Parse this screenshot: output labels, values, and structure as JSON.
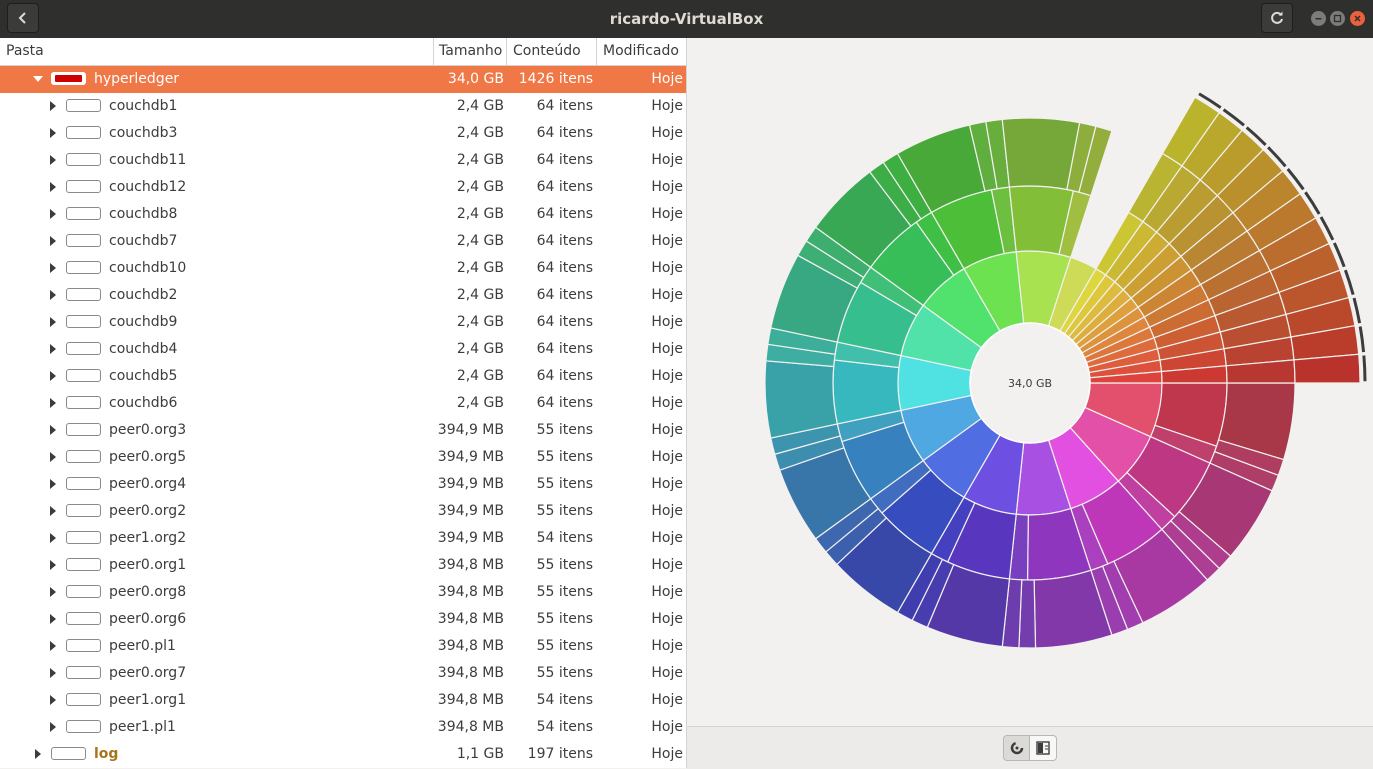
{
  "window": {
    "title": "ricardo-VirtualBox"
  },
  "columns": {
    "name": "Pasta",
    "size": "Tamanho",
    "contents": "Conteúdo",
    "modified": "Modificado"
  },
  "rows": [
    {
      "name": "hyperledger",
      "size": "34,0 GB",
      "contents": "1426 itens",
      "modified": "Hoje",
      "level": 0,
      "expanded": true,
      "selected": true
    },
    {
      "name": "couchdb1",
      "size": "2,4 GB",
      "contents": "64 itens",
      "modified": "Hoje",
      "level": 1
    },
    {
      "name": "couchdb3",
      "size": "2,4 GB",
      "contents": "64 itens",
      "modified": "Hoje",
      "level": 1
    },
    {
      "name": "couchdb11",
      "size": "2,4 GB",
      "contents": "64 itens",
      "modified": "Hoje",
      "level": 1
    },
    {
      "name": "couchdb12",
      "size": "2,4 GB",
      "contents": "64 itens",
      "modified": "Hoje",
      "level": 1
    },
    {
      "name": "couchdb8",
      "size": "2,4 GB",
      "contents": "64 itens",
      "modified": "Hoje",
      "level": 1
    },
    {
      "name": "couchdb7",
      "size": "2,4 GB",
      "contents": "64 itens",
      "modified": "Hoje",
      "level": 1
    },
    {
      "name": "couchdb10",
      "size": "2,4 GB",
      "contents": "64 itens",
      "modified": "Hoje",
      "level": 1
    },
    {
      "name": "couchdb2",
      "size": "2,4 GB",
      "contents": "64 itens",
      "modified": "Hoje",
      "level": 1
    },
    {
      "name": "couchdb9",
      "size": "2,4 GB",
      "contents": "64 itens",
      "modified": "Hoje",
      "level": 1
    },
    {
      "name": "couchdb4",
      "size": "2,4 GB",
      "contents": "64 itens",
      "modified": "Hoje",
      "level": 1
    },
    {
      "name": "couchdb5",
      "size": "2,4 GB",
      "contents": "64 itens",
      "modified": "Hoje",
      "level": 1
    },
    {
      "name": "couchdb6",
      "size": "2,4 GB",
      "contents": "64 itens",
      "modified": "Hoje",
      "level": 1
    },
    {
      "name": "peer0.org3",
      "size": "394,9 MB",
      "contents": "55 itens",
      "modified": "Hoje",
      "level": 1
    },
    {
      "name": "peer0.org5",
      "size": "394,9 MB",
      "contents": "55 itens",
      "modified": "Hoje",
      "level": 1
    },
    {
      "name": "peer0.org4",
      "size": "394,9 MB",
      "contents": "55 itens",
      "modified": "Hoje",
      "level": 1
    },
    {
      "name": "peer0.org2",
      "size": "394,9 MB",
      "contents": "55 itens",
      "modified": "Hoje",
      "level": 1
    },
    {
      "name": "peer1.org2",
      "size": "394,9 MB",
      "contents": "54 itens",
      "modified": "Hoje",
      "level": 1
    },
    {
      "name": "peer0.org1",
      "size": "394,8 MB",
      "contents": "55 itens",
      "modified": "Hoje",
      "level": 1
    },
    {
      "name": "peer0.org8",
      "size": "394,8 MB",
      "contents": "55 itens",
      "modified": "Hoje",
      "level": 1
    },
    {
      "name": "peer0.org6",
      "size": "394,8 MB",
      "contents": "55 itens",
      "modified": "Hoje",
      "level": 1
    },
    {
      "name": "peer0.pl1",
      "size": "394,8 MB",
      "contents": "55 itens",
      "modified": "Hoje",
      "level": 1
    },
    {
      "name": "peer0.org7",
      "size": "394,8 MB",
      "contents": "55 itens",
      "modified": "Hoje",
      "level": 1
    },
    {
      "name": "peer1.org1",
      "size": "394,8 MB",
      "contents": "54 itens",
      "modified": "Hoje",
      "level": 1
    },
    {
      "name": "peer1.pl1",
      "size": "394,8 MB",
      "contents": "54 itens",
      "modified": "Hoje",
      "level": 1
    },
    {
      "name": "log",
      "size": "1,1 GB",
      "contents": "197 itens",
      "modified": "Hoje",
      "level": 0,
      "highlight": true
    }
  ],
  "chart": {
    "center_label": "34,0 GB"
  },
  "colors": {
    "selection": "#f07746",
    "titlebar": "#2f2f2e",
    "log_text": "#a8731d",
    "close": "#e9623b"
  },
  "icons": {
    "back": "back-arrow-icon",
    "refresh": "refresh-icon",
    "ring_view": "ring-chart-icon",
    "treemap_view": "treemap-icon"
  }
}
